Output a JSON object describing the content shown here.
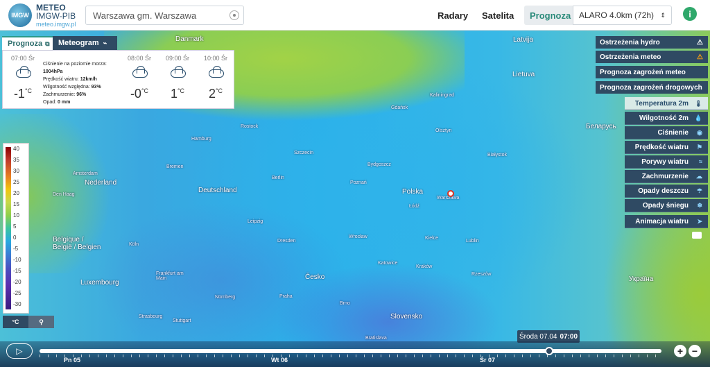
{
  "header": {
    "logo_text": "IMGW",
    "brand_line1": "METEO",
    "brand_line2": "IMGW-PIB",
    "brand_url": "meteo.imgw.pl",
    "search_value": "Warszawa gm. Warszawa",
    "nav": {
      "radary": "Radary",
      "satelita": "Satelita",
      "prognoza": "Prognoza"
    },
    "model_select": "ALARO 4.0km (72h)",
    "info_label": "i"
  },
  "tabs": {
    "prognoza": "Prognoza",
    "meteogram": "Meteogram"
  },
  "forecast": {
    "columns": [
      {
        "time": "07:00 Śr",
        "temp": "-1",
        "unit": "°C"
      },
      {
        "time": "08:00 Śr",
        "temp": "-0",
        "unit": "°C"
      },
      {
        "time": "09:00 Śr",
        "temp": "1",
        "unit": "°C"
      },
      {
        "time": "10:00 Śr",
        "temp": "2",
        "unit": "°C"
      }
    ],
    "details": [
      {
        "label": "Ciśnienie na poziomie morza:",
        "value": ""
      },
      {
        "label": "",
        "value": "1004hPa"
      },
      {
        "label": "Prędkość wiatru:",
        "value": "12km/h"
      },
      {
        "label": "Wilgotność względna:",
        "value": "93%"
      },
      {
        "label": "Zachmurzenie:",
        "value": "96%"
      },
      {
        "label": "Opad:",
        "value": "0 mm"
      }
    ]
  },
  "legend": {
    "values": [
      "40",
      "35",
      "30",
      "25",
      "20",
      "15",
      "10",
      "5",
      "0",
      "-5",
      "-10",
      "-15",
      "-20",
      "-25",
      "-30"
    ],
    "unit_btn": "°C",
    "pin_btn": "⚲"
  },
  "right_menu": {
    "hydro": "Ostrzeżenia hydro",
    "meteo": "Ostrzeżenia meteo",
    "zagrozen_meteo": "Prognoza zagrożeń meteo",
    "zagrozen_drog": "Prognoza zagrożeń drogowych"
  },
  "layers": [
    {
      "label": "Temperatura 2m",
      "icon": "🌡"
    },
    {
      "label": "Wilgotność 2m",
      "icon": "💧"
    },
    {
      "label": "Ciśnienie",
      "icon": "◉"
    },
    {
      "label": "Prędkość wiatru",
      "icon": "⚑"
    },
    {
      "label": "Porywy wiatru",
      "icon": "≈"
    },
    {
      "label": "Zachmurzenie",
      "icon": "☁"
    },
    {
      "label": "Opady deszczu",
      "icon": "☂"
    },
    {
      "label": "Opady śniegu",
      "icon": "❄"
    },
    {
      "label": "Animacja wiatru",
      "icon": "➤"
    }
  ],
  "timeline": {
    "play": "▷",
    "tooltip_day": "Środa 07.04",
    "tooltip_time": "07:00",
    "days": [
      "Pn 05",
      "Wt 06",
      "Śr 07"
    ],
    "zoom_in": "+",
    "zoom_out": "−"
  },
  "map_labels": {
    "countries": [
      "Danmark",
      "Deutschland",
      "Polska",
      "Nederland",
      "Česko",
      "Slovensko",
      "Lietuva",
      "Latvija",
      "Беларусь",
      "Україна",
      "Belgique / België / Belgien",
      "Luxembourg"
    ],
    "cities": [
      "Warszawa",
      "Gdańsk",
      "Kraków",
      "Poznań",
      "Wrocław",
      "Łódź",
      "Berlin",
      "Hamburg",
      "Leipzig",
      "Dresden",
      "Bremen",
      "Praha",
      "Bydgoszcz",
      "Szczecin",
      "Rostock",
      "Kaliningrad",
      "Białystok",
      "Lublin",
      "Katowice",
      "Kielce",
      "Köln",
      "Frankfurt am Main",
      "Nürnberg",
      "Stuttgart",
      "Strasbourg",
      "Den Haag",
      "Amsterdam",
      "Bratislava",
      "Rzeszów",
      "Olsztyn",
      "Brno"
    ]
  }
}
